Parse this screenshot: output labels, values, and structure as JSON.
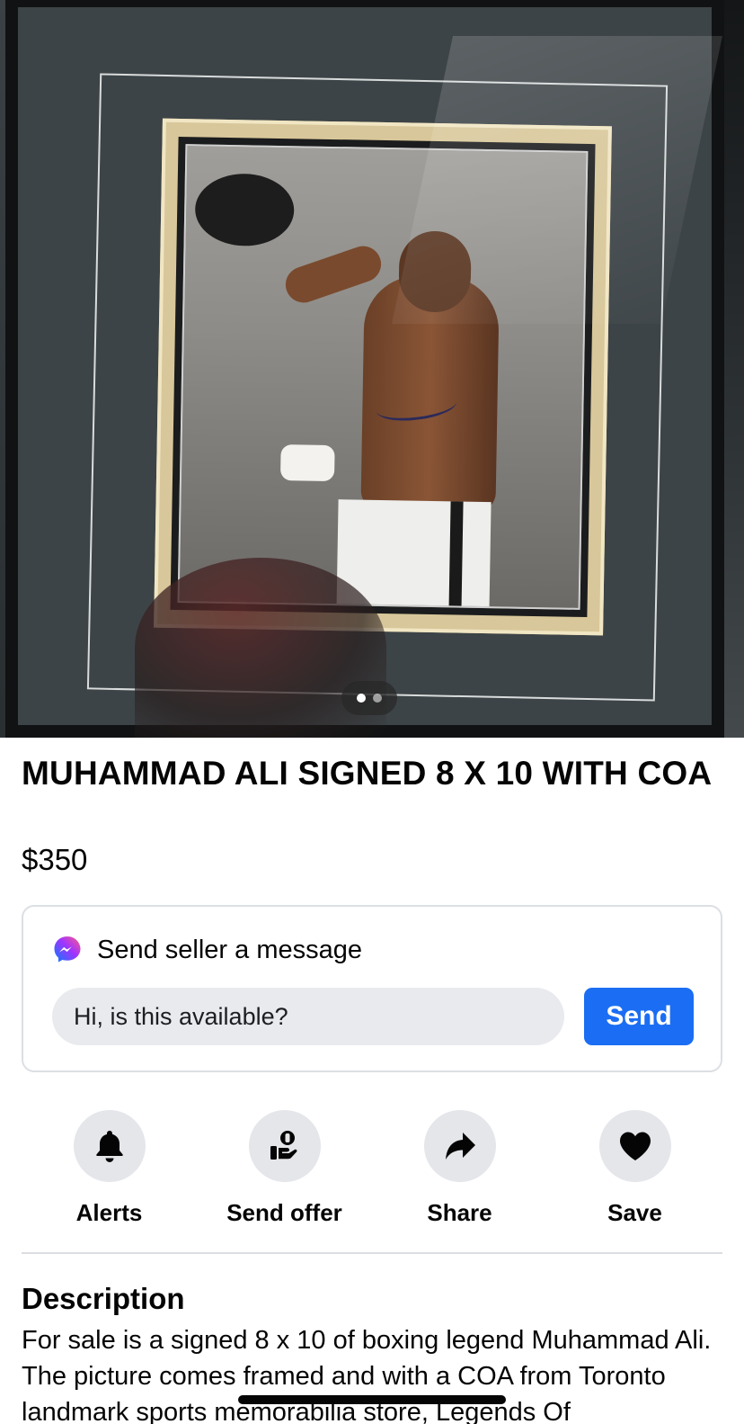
{
  "gallery": {
    "image_count": 2,
    "active_index": 0
  },
  "listing": {
    "title": "MUHAMMAD ALI SIGNED 8 X 10 WITH COA",
    "price": "$350"
  },
  "message_card": {
    "icon": "messenger-icon",
    "heading": "Send seller a message",
    "input_value": "Hi, is this available?",
    "send_label": "Send",
    "accent_color": "#1b6ef3"
  },
  "actions": [
    {
      "icon": "bell-icon",
      "label": "Alerts"
    },
    {
      "icon": "send-offer-icon",
      "label": "Send offer"
    },
    {
      "icon": "share-arrow-icon",
      "label": "Share"
    },
    {
      "icon": "heart-icon",
      "label": "Save"
    }
  ],
  "description": {
    "heading": "Description",
    "text": "For sale is a signed 8 x 10 of boxing legend Muhammad Ali. The picture comes framed and with a COA from Toronto landmark sports memorabilia store, Legends Of"
  }
}
